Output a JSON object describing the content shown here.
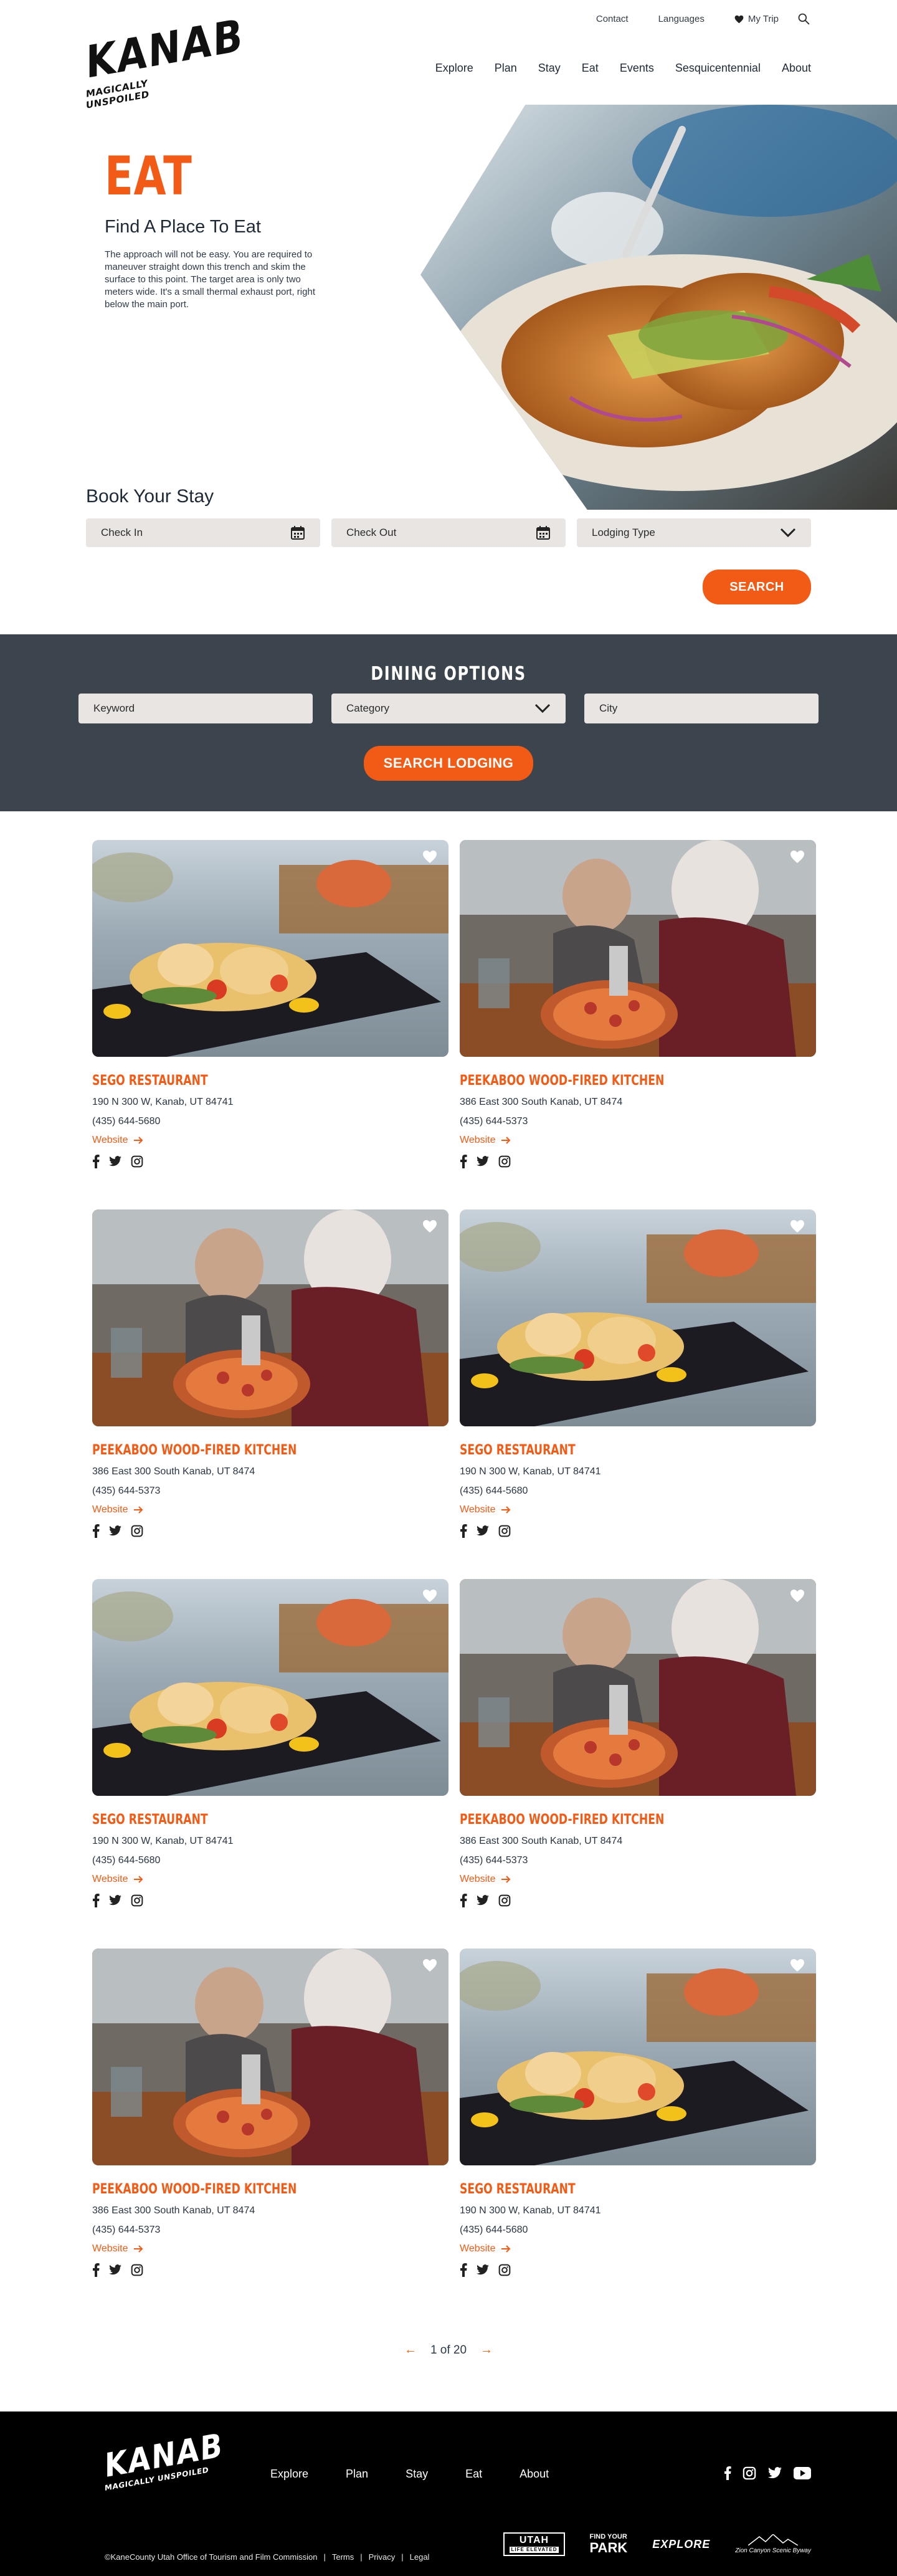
{
  "brand": {
    "logo_word": "KANAB",
    "logo_tagline": "MAGICALLY UNSPOILED"
  },
  "utility_nav": {
    "contact": "Contact",
    "languages": "Languages",
    "my_trip": "My Trip"
  },
  "main_nav": [
    "Explore",
    "Plan",
    "Stay",
    "Eat",
    "Events",
    "Sesquicentennial",
    "About"
  ],
  "hero": {
    "title": "EAT",
    "subtitle": "Find A Place To Eat",
    "body": "The approach will not be easy. You are required to maneuver straight down this trench and skim the surface to this point. The target area is only two meters wide. It's a small thermal exhaust port, right below the main port."
  },
  "book_stay": {
    "title": "Book Your Stay",
    "check_in": "Check In",
    "check_out": "Check Out",
    "lodging_type": "Lodging Type",
    "search_label": "SEARCH"
  },
  "dining": {
    "title": "DINING OPTIONS",
    "keyword": "Keyword",
    "category": "Category",
    "city": "City",
    "search_label": "SEARCH LODGING"
  },
  "listings": [
    {
      "name": "SEGO RESTAURANT",
      "address": "190 N 300 W, Kanab, UT 84741",
      "phone": "(435) 644-5680",
      "website": "Website",
      "photo": "plate"
    },
    {
      "name": "PEEKABOO WOOD-FIRED KITCHEN",
      "address": "386 East 300 South Kanab, UT 8474",
      "phone": "(435) 644-5373",
      "website": "Website",
      "photo": "pizza"
    },
    {
      "name": "PEEKABOO WOOD-FIRED KITCHEN",
      "address": "386 East 300 South Kanab, UT 8474",
      "phone": "(435) 644-5373",
      "website": "Website",
      "photo": "pizza"
    },
    {
      "name": "SEGO RESTAURANT",
      "address": "190 N 300 W, Kanab, UT 84741",
      "phone": "(435) 644-5680",
      "website": "Website",
      "photo": "plate"
    },
    {
      "name": "SEGO RESTAURANT",
      "address": "190 N 300 W, Kanab, UT 84741",
      "phone": "(435) 644-5680",
      "website": "Website",
      "photo": "plate"
    },
    {
      "name": "PEEKABOO WOOD-FIRED KITCHEN",
      "address": "386 East 300 South Kanab, UT 8474",
      "phone": "(435) 644-5373",
      "website": "Website",
      "photo": "pizza"
    },
    {
      "name": "PEEKABOO WOOD-FIRED KITCHEN",
      "address": "386 East 300 South Kanab, UT 8474",
      "phone": "(435) 644-5373",
      "website": "Website",
      "photo": "pizza"
    },
    {
      "name": "SEGO RESTAURANT",
      "address": "190 N 300 W, Kanab, UT 84741",
      "phone": "(435) 644-5680",
      "website": "Website",
      "photo": "plate"
    }
  ],
  "pagination": {
    "label": "1 of 20"
  },
  "footer": {
    "logo_word": "KANAB",
    "logo_tagline": "MAGICALLY UNSPOILED",
    "nav": [
      "Explore",
      "Plan",
      "Stay",
      "Eat",
      "About"
    ],
    "copyright": "©KaneCounty Utah Office of Tourism and Film Commission",
    "legal_links": [
      "Terms",
      "Privacy",
      "Legal"
    ],
    "badges": {
      "utah": "UTAH",
      "utah_sub": "LIFE ELEVATED",
      "park_top": "FIND YOUR",
      "park_bottom": "PARK",
      "explore": "EXPLORE",
      "scenic": "Zion Canyon Scenic Byway"
    }
  },
  "colors": {
    "accent": "#f25b15",
    "band": "#3c454e",
    "field": "#e9e5e3",
    "footer": "#000000"
  },
  "icons": {
    "search": "search-icon",
    "heart": "heart-icon",
    "calendar": "calendar-icon",
    "chevron": "chevron-down-icon",
    "arrow": "arrow-right-icon"
  }
}
